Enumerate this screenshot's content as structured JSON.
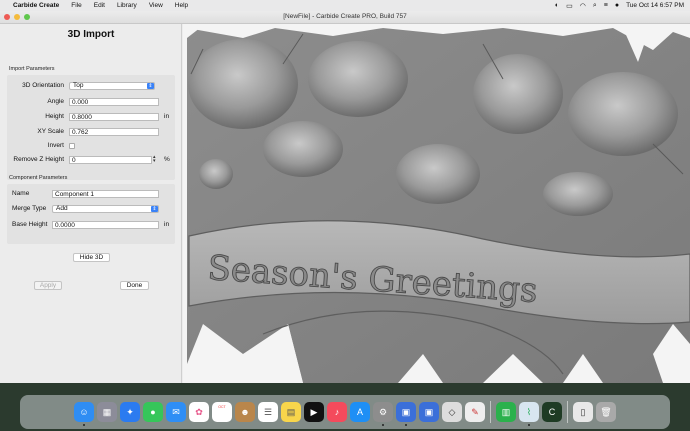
{
  "menubar": {
    "app_name": "Carbide Create",
    "menus": [
      "File",
      "Edit",
      "Library",
      "View",
      "Help"
    ],
    "datetime": "Tue Oct 14  6:57 PM"
  },
  "window": {
    "title": "[NewFile] - Carbide Create PRO, Build 757"
  },
  "panel": {
    "title": "3D Import",
    "import_section_label": "Import Parameters",
    "orientation": {
      "label": "3D Orientation",
      "value": "Top"
    },
    "angle": {
      "label": "Angle",
      "value": "0.000"
    },
    "height": {
      "label": "Height",
      "value": "0.8000",
      "unit": "in"
    },
    "xy_scale": {
      "label": "XY Scale",
      "value": "0.762"
    },
    "invert": {
      "label": "Invert",
      "checked": false
    },
    "remove_z": {
      "label": "Remove Z Height",
      "value": "0",
      "unit": "%"
    },
    "component_section_label": "Component Parameters",
    "name": {
      "label": "Name",
      "value": "Component 1"
    },
    "merge_type": {
      "label": "Merge Type",
      "value": "Add"
    },
    "base_height": {
      "label": "Base Height",
      "value": "0.0000",
      "unit": "in"
    },
    "hide_3d_label": "Hide 3D",
    "apply_label": "Apply",
    "done_label": "Done"
  },
  "viewport": {
    "banner_text": "Season's Greetings"
  },
  "calendar": {
    "month": "OCT",
    "day": "14"
  },
  "dock": {
    "icons": [
      "finder-icon",
      "launchpad-icon",
      "safari-icon",
      "messages-icon",
      "mail-icon",
      "photos-icon",
      "calendar-icon",
      "contacts-icon",
      "reminders-icon",
      "notes-icon",
      "apple-tv-icon",
      "music-icon",
      "app-store-icon",
      "system-settings-icon",
      "screen-sharing-icon",
      "carbide-icon",
      "roblox-icon",
      "texteditor-icon",
      "numbers-icon",
      "carbide-create-icon",
      "carbide-motion-icon",
      "preview-icon",
      "trash-icon"
    ]
  }
}
